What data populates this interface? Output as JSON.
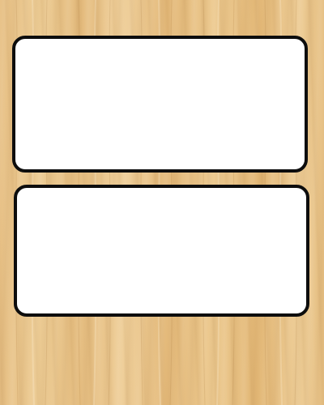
{
  "background": {
    "texture": "light-maple-wood",
    "base_color": "#e9c48a"
  },
  "panels": [
    {
      "text": ""
    },
    {
      "text": ""
    }
  ],
  "colors": {
    "panel_fill": "#ffffff",
    "panel_border": "#0d0d0d"
  }
}
